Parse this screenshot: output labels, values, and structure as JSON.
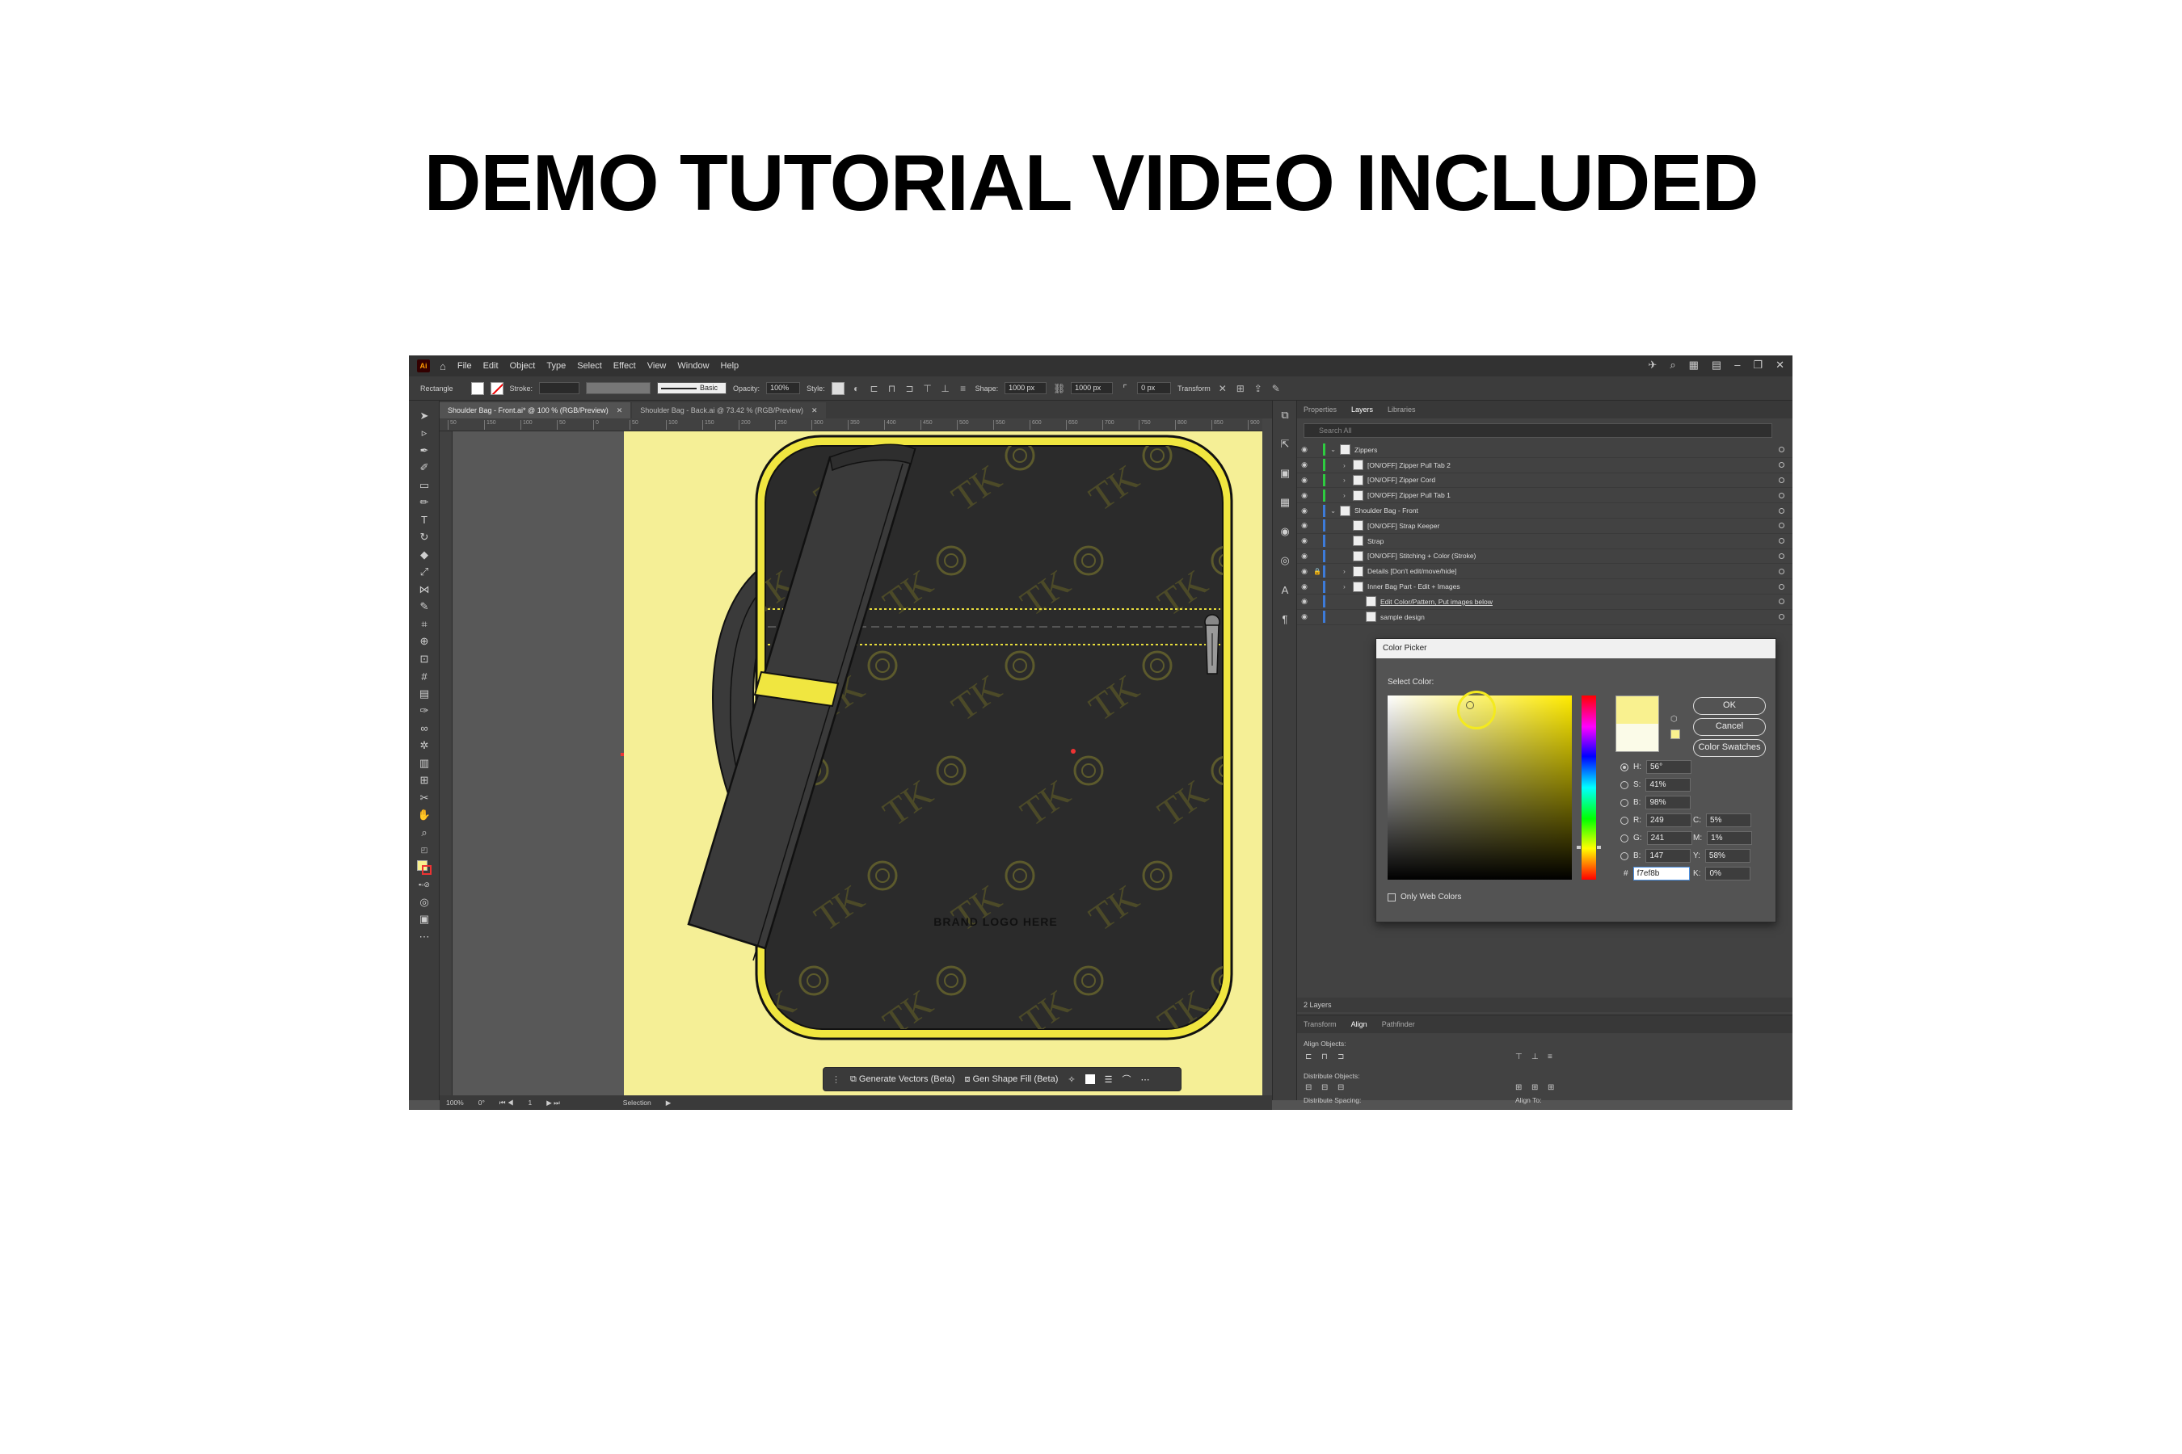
{
  "headline": "DEMO TUTORIAL VIDEO INCLUDED",
  "menubar": {
    "app_badge": "Ai",
    "items": [
      "File",
      "Edit",
      "Object",
      "Type",
      "Select",
      "Effect",
      "View",
      "Window",
      "Help"
    ]
  },
  "controlbar": {
    "tool_name": "Rectangle",
    "stroke_label": "Stroke:",
    "brush_label": "Basic",
    "opacity_label": "Opacity:",
    "opacity_value": "100%",
    "style_label": "Style:",
    "shape_label": "Shape:",
    "width_value": "1000 px",
    "height_value": "1000 px",
    "corner_value": "0 px",
    "transform_label": "Transform"
  },
  "tabs": [
    {
      "label": "Shoulder Bag - Front.ai* @ 100 % (RGB/Preview)",
      "active": true
    },
    {
      "label": "Shoulder Bag - Back.ai @ 73.42 % (RGB/Preview)",
      "active": false
    }
  ],
  "ruler_ticks": [
    "50",
    "150",
    "100",
    "50",
    "0",
    "50",
    "100",
    "150",
    "200",
    "250",
    "300",
    "350",
    "400",
    "450",
    "500",
    "550",
    "600",
    "650",
    "700",
    "750",
    "800",
    "850",
    "900"
  ],
  "panel_tabs": [
    "Properties",
    "Layers",
    "Libraries"
  ],
  "layers_search_placeholder": "Search All",
  "layers": [
    {
      "name": "Zippers",
      "color": "#2ecc40",
      "indent": 0
    },
    {
      "name": "[ON/OFF] Zipper Pull Tab 2",
      "color": "#2ecc40",
      "indent": 1
    },
    {
      "name": "[ON/OFF] Zipper Cord",
      "color": "#2ecc40",
      "indent": 1
    },
    {
      "name": "[ON/OFF] Zipper Pull Tab 1",
      "color": "#2ecc40",
      "indent": 1
    },
    {
      "name": "Shoulder Bag - Front",
      "color": "#3d7bd9",
      "indent": 0
    },
    {
      "name": "[ON/OFF] Strap Keeper",
      "color": "#3d7bd9",
      "indent": 1
    },
    {
      "name": "Strap",
      "color": "#3d7bd9",
      "indent": 1
    },
    {
      "name": "[ON/OFF] Stitching + Color (Stroke)",
      "color": "#3d7bd9",
      "indent": 1
    },
    {
      "name": "Details [Don't edit/move/hide]",
      "color": "#3d7bd9",
      "indent": 1
    },
    {
      "name": "Inner Bag Part - Edit + Images",
      "color": "#3d7bd9",
      "indent": 1
    },
    {
      "name": "Edit Color/Pattern, Put images below",
      "color": "#3d7bd9",
      "indent": 2
    },
    {
      "name": "sample design",
      "color": "#3d7bd9",
      "indent": 2
    }
  ],
  "layers_footer": "2 Layers",
  "align_panel": {
    "tabs": [
      "Transform",
      "Align",
      "Pathfinder"
    ],
    "align_objects": "Align Objects:",
    "distribute_objects": "Distribute Objects:",
    "distribute_spacing": "Distribute Spacing:",
    "align_to": "Align To:"
  },
  "color_picker": {
    "title": "Color Picker",
    "select_label": "Select Color:",
    "ok": "OK",
    "cancel": "Cancel",
    "swatches": "Color Swatches",
    "h": "56°",
    "s": "41%",
    "b": "98%",
    "r": "249",
    "g": "241",
    "b_rgb": "147",
    "c": "5%",
    "m": "1%",
    "y": "58%",
    "k": "0%",
    "hex": "f7ef8b",
    "hex_prefix": "#",
    "web_only": "Only Web Colors",
    "new_color": "#f9f18f",
    "old_color": "#fbfbe8"
  },
  "artwork": {
    "monogram": "TK",
    "logo_text": "BRAND LOGO HERE",
    "artboard_color": "#f5ef96",
    "bag_color": "#2b2b2b",
    "trim_color": "#f0e640"
  },
  "contextual_bar": {
    "generate": "Generate Vectors (Beta)",
    "gen_fill": "Gen Shape Fill (Beta)"
  },
  "statusbar": {
    "zoom": "100%",
    "rotation": "0°",
    "artboard": "1",
    "tool": "Selection"
  }
}
